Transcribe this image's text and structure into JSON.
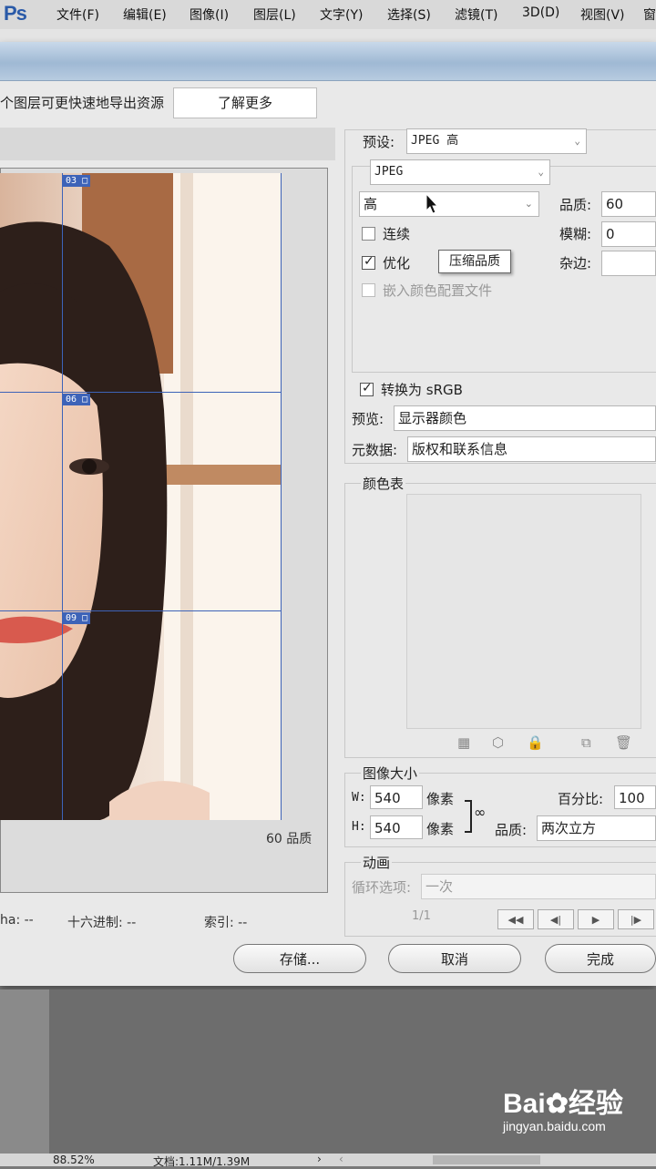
{
  "app": {
    "logo": "Ps"
  },
  "menu": [
    "文件(F)",
    "编辑(E)",
    "图像(I)",
    "图层(L)",
    "文字(Y)",
    "选择(S)",
    "滤镜(T)",
    "3D(D)",
    "视图(V)",
    "窗"
  ],
  "top_bar": {
    "note": "个图层可更快速地导出资源",
    "learn_more": "了解更多"
  },
  "preview": {
    "slices": [
      "03",
      "06",
      "09"
    ],
    "quality_note": "60 品质",
    "status": {
      "alpha": "ha: --",
      "hex": "十六进制: --",
      "index": "索引: --"
    }
  },
  "settings": {
    "preset_label": "预设:",
    "preset_value": "JPEG 高",
    "format_value": "JPEG",
    "quality_level": "高",
    "quality_label": "品质:",
    "quality_value": "60",
    "blur_label": "模糊:",
    "blur_value": "0",
    "matte_label": "杂边:",
    "matte_value": "",
    "progressive": {
      "label": "连续",
      "checked": false
    },
    "optimized": {
      "label": "优化",
      "checked": true
    },
    "embed_profile": {
      "label": "嵌入颜色配置文件",
      "checked": false
    },
    "tooltip": "压缩品质",
    "convert_srgb": {
      "label": "转换为 sRGB",
      "checked": true
    },
    "preview_label": "预览:",
    "preview_value": "显示器颜色",
    "metadata_label": "元数据:",
    "metadata_value": "版权和联系信息"
  },
  "color_table": {
    "title": "颜色表"
  },
  "image_size": {
    "title": "图像大小",
    "w_label": "W:",
    "w_value": "540",
    "h_label": "H:",
    "h_value": "540",
    "unit": "像素",
    "percent_label": "百分比:",
    "percent_value": "100",
    "quality_label": "品质:",
    "quality_value": "两次立方"
  },
  "animation": {
    "title": "动画",
    "loop_label": "循环选项:",
    "loop_value": "一次",
    "frame": "1/1"
  },
  "buttons": {
    "save": "存储...",
    "cancel": "取消",
    "done": "完成"
  },
  "bottom_status": {
    "zoom": "88.52%",
    "doc": "文档:1.11M/1.39M"
  },
  "watermark": {
    "brand": "Bai",
    "brand2": "经验",
    "url": "jingyan.baidu.com"
  }
}
